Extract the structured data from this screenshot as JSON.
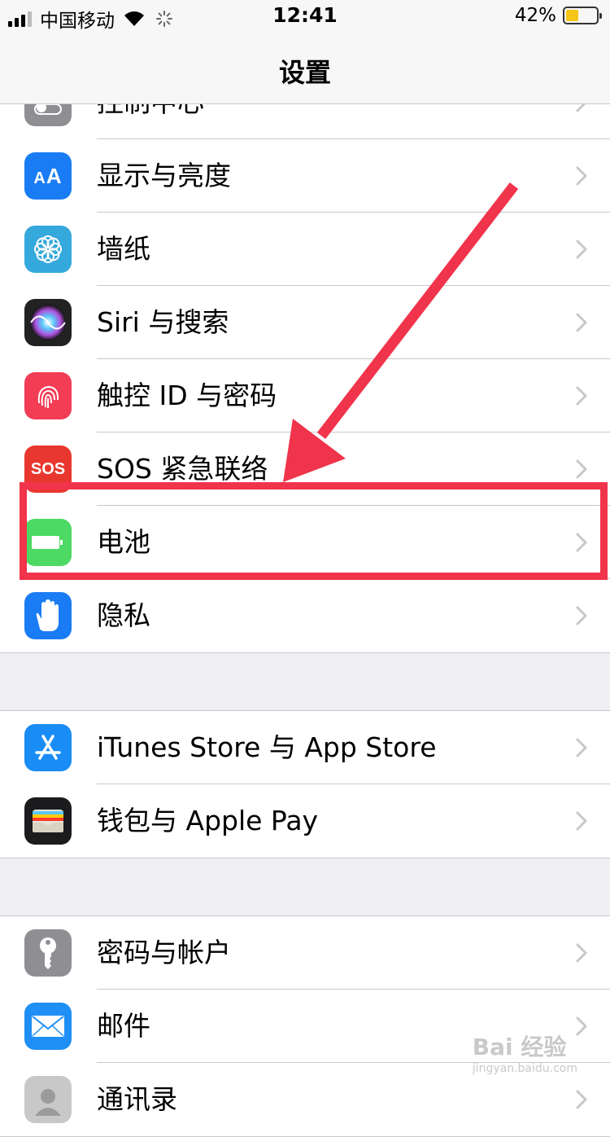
{
  "status_bar": {
    "carrier": "中国移动",
    "time": "12:41",
    "battery_percent": "42%",
    "battery_level": 0.42,
    "battery_color": "#f5c518"
  },
  "nav": {
    "title": "设置"
  },
  "sections": [
    {
      "items": [
        {
          "label": "控制中心",
          "icon": "control-center-icon",
          "color": "#8e8e93"
        },
        {
          "label": "显示与亮度",
          "icon": "display-brightness-icon",
          "color": "#1a7cf5"
        },
        {
          "label": "墙纸",
          "icon": "wallpaper-icon",
          "color": "#35a9dc"
        },
        {
          "label": "Siri 与搜索",
          "icon": "siri-icon",
          "color": "#222"
        },
        {
          "label": "触控 ID 与密码",
          "icon": "touch-id-icon",
          "color": "#f23d55"
        },
        {
          "label": "SOS 紧急联络",
          "icon": "sos-icon",
          "color": "#e8372e",
          "icon_text": "SOS"
        },
        {
          "label": "电池",
          "icon": "battery-icon",
          "color": "#4cd964"
        },
        {
          "label": "隐私",
          "icon": "privacy-hand-icon",
          "color": "#1a7cf5"
        }
      ]
    },
    {
      "items": [
        {
          "label": "iTunes Store 与 App Store",
          "icon": "app-store-icon",
          "color": "#1a8cf5"
        },
        {
          "label": "钱包与 Apple Pay",
          "icon": "wallet-icon",
          "color": "#1c1c1e"
        }
      ]
    },
    {
      "items": [
        {
          "label": "密码与帐户",
          "icon": "key-icon",
          "color": "#8e8e93"
        },
        {
          "label": "邮件",
          "icon": "mail-icon",
          "color": "#1f8ff5"
        },
        {
          "label": "通讯录",
          "icon": "contacts-icon",
          "color": "#c8c8c8"
        }
      ]
    }
  ],
  "annotation_color": "#f0344b",
  "watermark": {
    "brand": "Bai 经验",
    "url": "jingyan.baidu.com"
  }
}
